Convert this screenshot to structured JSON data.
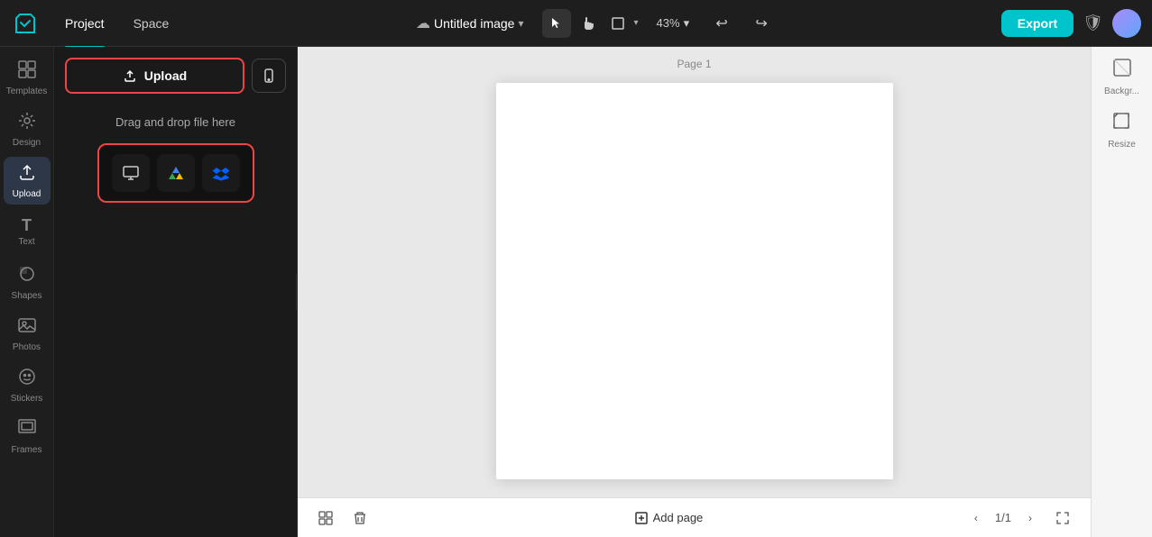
{
  "header": {
    "title": "Untitled image",
    "project_tab": "Project",
    "space_tab": "Space",
    "zoom_level": "43%",
    "export_label": "Export"
  },
  "sidebar": {
    "items": [
      {
        "id": "templates",
        "label": "Templates",
        "icon": "⊞"
      },
      {
        "id": "design",
        "label": "Design",
        "icon": "✦"
      },
      {
        "id": "upload",
        "label": "Upload",
        "icon": "☁"
      },
      {
        "id": "text",
        "label": "Text",
        "icon": "T"
      },
      {
        "id": "shapes",
        "label": "Shapes",
        "icon": "◯"
      },
      {
        "id": "photos",
        "label": "Photos",
        "icon": "🖼"
      },
      {
        "id": "stickers",
        "label": "Stickers",
        "icon": "😊"
      },
      {
        "id": "frames",
        "label": "Frames",
        "icon": "▭"
      }
    ],
    "active": "upload"
  },
  "panel": {
    "upload_button_label": "Upload",
    "drag_drop_text": "Drag and drop file here"
  },
  "canvas": {
    "page_label": "Page 1"
  },
  "bottom_bar": {
    "add_page_label": "Add page",
    "page_indicator": "1/1"
  },
  "right_panel": {
    "items": [
      {
        "id": "background",
        "label": "Backgr..."
      },
      {
        "id": "resize",
        "label": "Resize"
      }
    ]
  }
}
